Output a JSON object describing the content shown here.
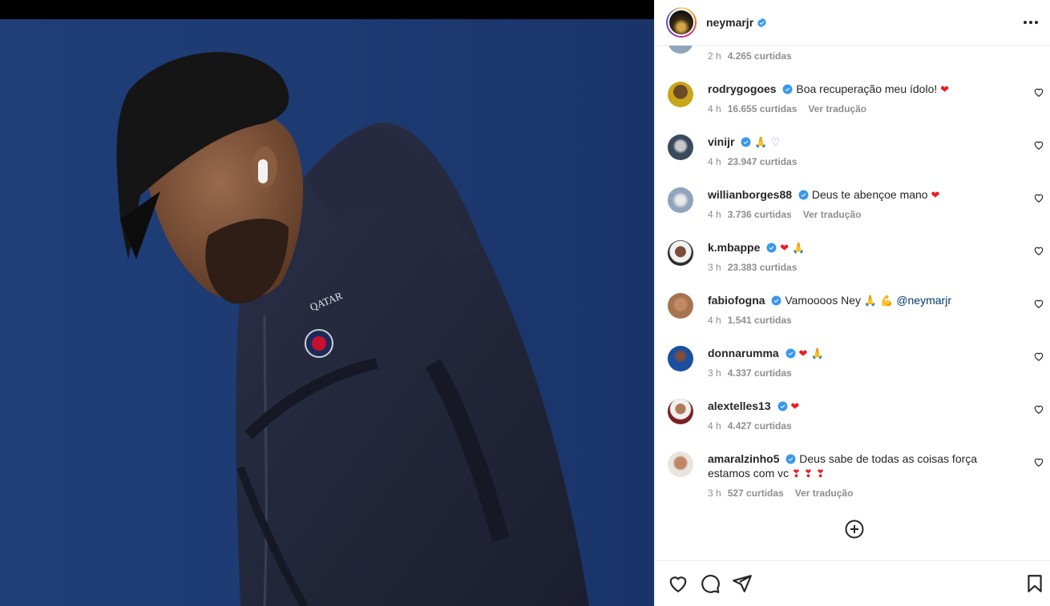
{
  "post": {
    "author": "neymarjr",
    "verified": true
  },
  "partial_comment": {
    "time": "2 h",
    "likes": "4.265 curtidas"
  },
  "comments": [
    {
      "user": "rodrygogoes",
      "text": "Boa recuperação meu ídolo! ",
      "emoji": "❤",
      "time": "4 h",
      "likes": "16.655 curtidas",
      "translate": "Ver tradução",
      "avatar_color": "#c9a51a"
    },
    {
      "user": "vinijr",
      "text": "",
      "emoji": "🙏 ♡",
      "time": "4 h",
      "likes": "23.947 curtidas",
      "translate": "",
      "avatar_color": "#3a4a5c"
    },
    {
      "user": "willianborges88",
      "text": "Deus te abençoe mano ",
      "emoji": "❤",
      "time": "4 h",
      "likes": "3.736 curtidas",
      "translate": "Ver tradução",
      "avatar_color": "#8fa4bd"
    },
    {
      "user": "k.mbappe",
      "text": "",
      "emoji": "❤ 🙏",
      "time": "3 h",
      "likes": "23.383 curtidas",
      "translate": "",
      "avatar_color": "#2b2b2b"
    },
    {
      "user": "fabiofogna",
      "text": "Vamoooos Ney ",
      "emoji": "🙏 💪",
      "mention": "@neymarjr",
      "time": "4 h",
      "likes": "1.541 curtidas",
      "translate": "",
      "avatar_color": "#a8744f"
    },
    {
      "user": "donnarumma",
      "text": "",
      "emoji": "❤ 🙏",
      "time": "3 h",
      "likes": "4.337 curtidas",
      "translate": "",
      "avatar_color": "#1b4fa0"
    },
    {
      "user": "alextelles13",
      "text": "",
      "emoji": "❤",
      "time": "4 h",
      "likes": "4.427 curtidas",
      "translate": "",
      "avatar_color": "#7a5c4a"
    },
    {
      "user": "amaralzinho5",
      "text": "Deus sabe de todas as coisas força estamos com vc ",
      "emoji": "❣ ❣ ❣",
      "time": "3 h",
      "likes": "527 curtidas",
      "translate": "Ver tradução",
      "avatar_color": "#d9a88a"
    }
  ],
  "icons": {
    "more": "more-horizontal-icon",
    "like": "heart-icon",
    "comment": "comment-icon",
    "share": "share-icon",
    "save": "bookmark-icon",
    "load_more": "plus-circle-icon"
  },
  "colors": {
    "verified": "#3897f0",
    "heart": "#ed1c24",
    "muted_text": "#8e8e8e",
    "mention": "#00376b"
  }
}
